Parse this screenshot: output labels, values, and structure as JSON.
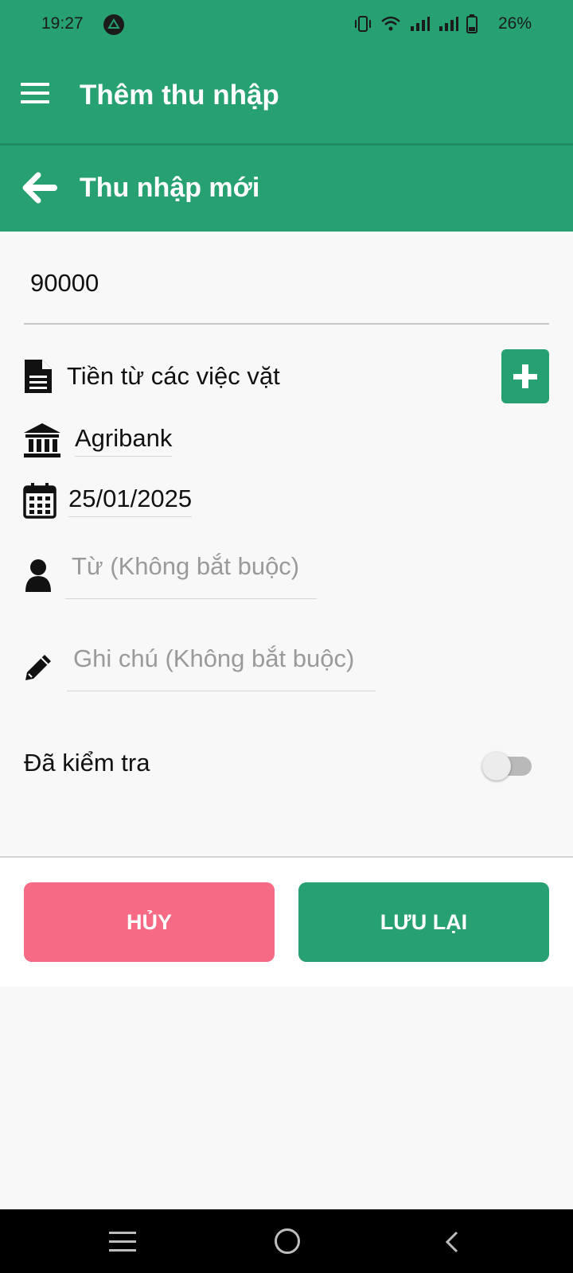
{
  "status_bar": {
    "time": "19:27",
    "battery": "26%"
  },
  "app_bar": {
    "title": "Thêm thu nhập",
    "menu_icon": "hamburger-menu-icon"
  },
  "sub_header": {
    "title": "Thu nhập mới",
    "back_icon": "arrow-left-icon"
  },
  "form": {
    "amount": "90000",
    "category": {
      "icon": "document-icon",
      "value": "Tiền từ các việc vặt"
    },
    "account": {
      "icon": "bank-icon",
      "value": "Agribank"
    },
    "date": {
      "icon": "calendar-icon",
      "value": "25/01/2025"
    },
    "from": {
      "icon": "person-icon",
      "placeholder": "Từ (Không bắt buộc)",
      "value": ""
    },
    "note": {
      "icon": "pencil-icon",
      "placeholder": "Ghi chú (Không bắt buộc)",
      "value": ""
    },
    "checked": {
      "label": "Đã kiểm tra",
      "on": false
    }
  },
  "actions": {
    "cancel_label": "HỦY",
    "save_label": "LƯU LẠI"
  },
  "colors": {
    "primary": "#27a072",
    "cancel": "#f76a86",
    "background": "#f8f8f8"
  }
}
